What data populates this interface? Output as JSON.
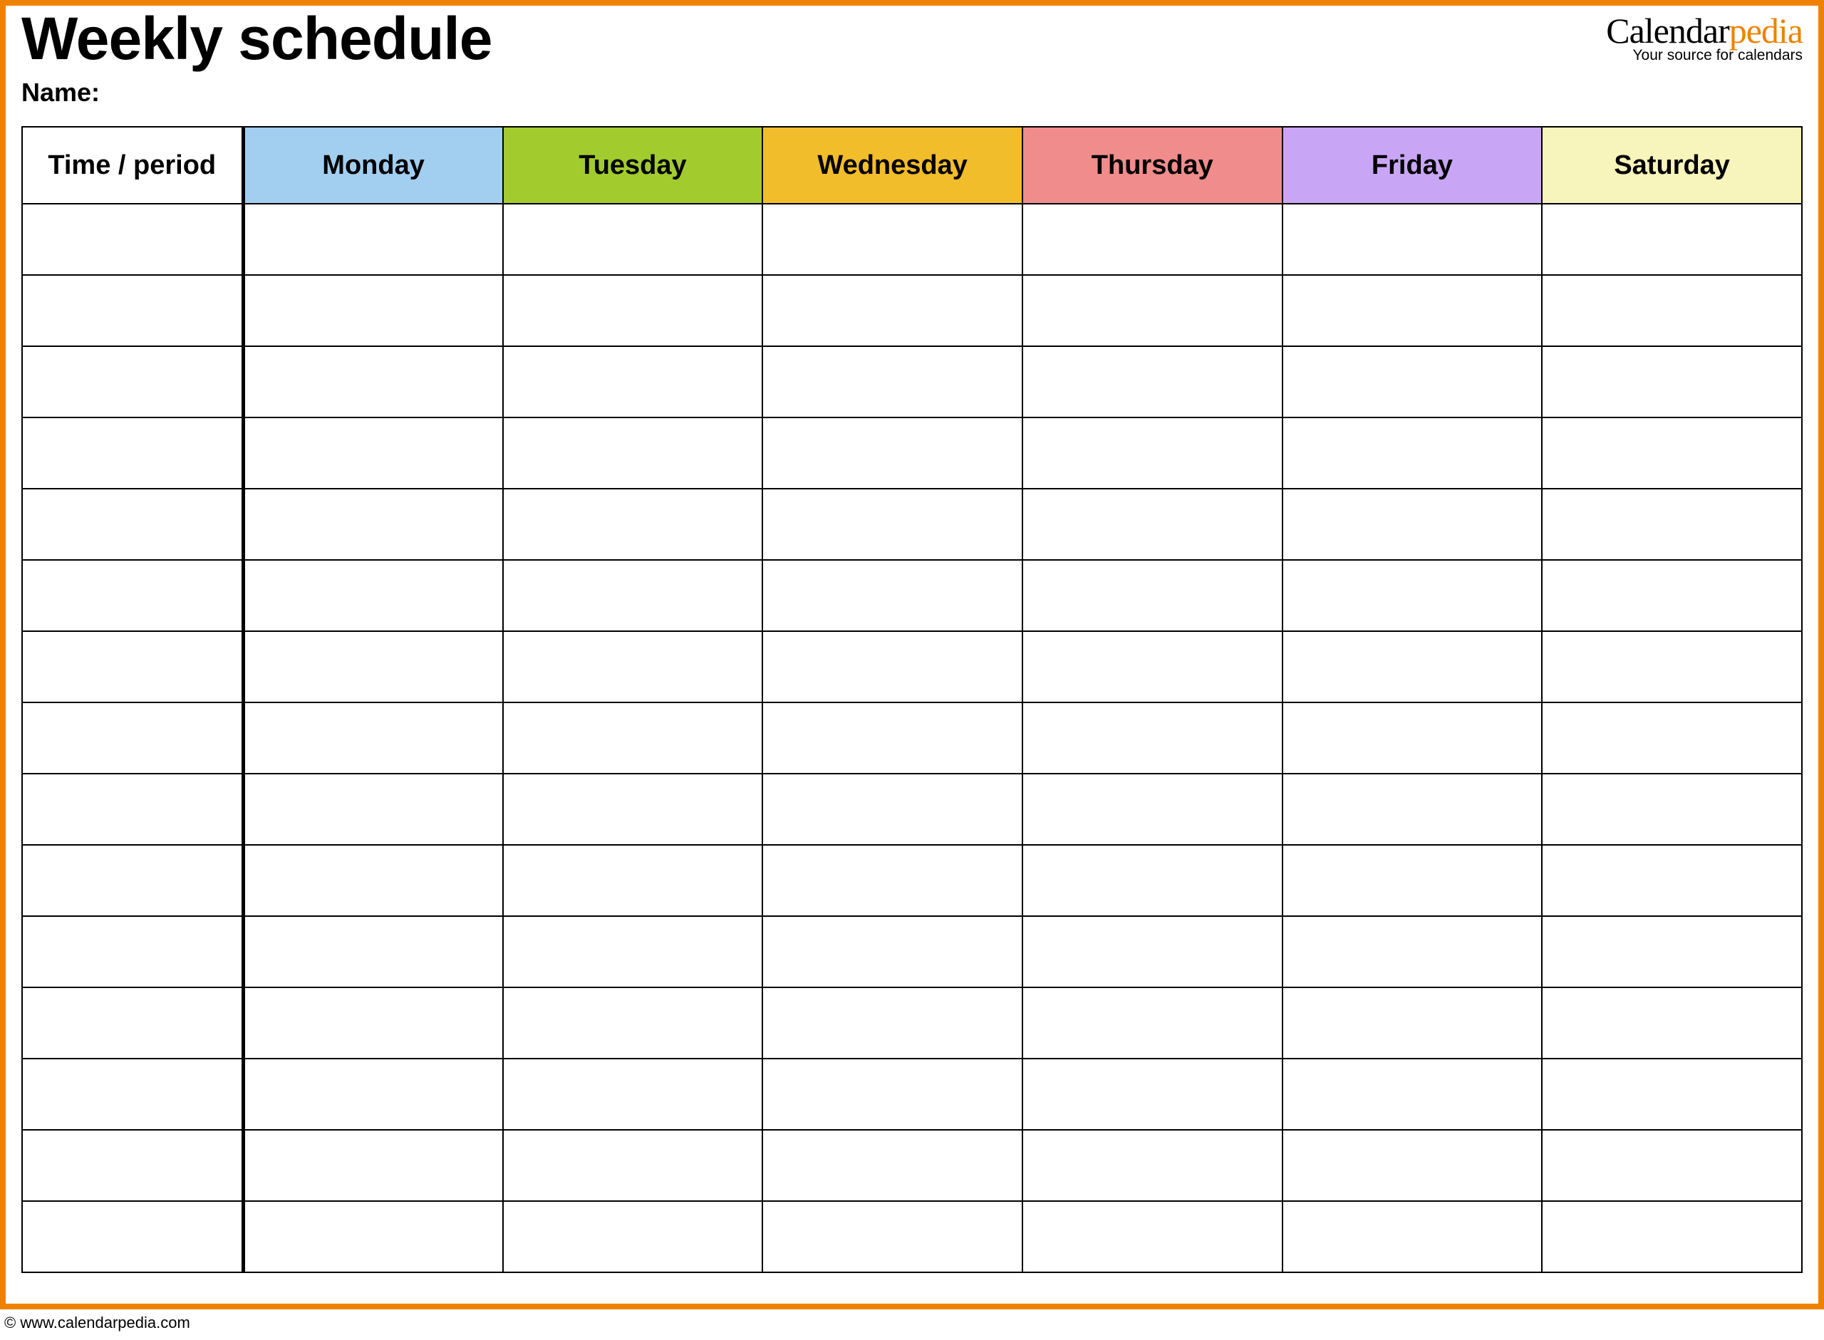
{
  "title": "Weekly schedule",
  "name_label": "Name:",
  "brand": {
    "prefix": "Calendar",
    "suffix": "pedia",
    "tag": "Your source for calendars"
  },
  "columns": {
    "time": {
      "label": "Time / period",
      "color": "#ffffff"
    },
    "days": [
      {
        "label": "Monday",
        "color": "#a2cef0"
      },
      {
        "label": "Tuesday",
        "color": "#a2cb2e"
      },
      {
        "label": "Wednesday",
        "color": "#f2bd2a"
      },
      {
        "label": "Thursday",
        "color": "#f08c8c"
      },
      {
        "label": "Friday",
        "color": "#c9a6f5"
      },
      {
        "label": "Saturday",
        "color": "#f7f4bc"
      }
    ]
  },
  "rows": [
    {
      "time": "",
      "cells": [
        "",
        "",
        "",
        "",
        "",
        ""
      ]
    },
    {
      "time": "",
      "cells": [
        "",
        "",
        "",
        "",
        "",
        ""
      ]
    },
    {
      "time": "",
      "cells": [
        "",
        "",
        "",
        "",
        "",
        ""
      ]
    },
    {
      "time": "",
      "cells": [
        "",
        "",
        "",
        "",
        "",
        ""
      ]
    },
    {
      "time": "",
      "cells": [
        "",
        "",
        "",
        "",
        "",
        ""
      ]
    },
    {
      "time": "",
      "cells": [
        "",
        "",
        "",
        "",
        "",
        ""
      ]
    },
    {
      "time": "",
      "cells": [
        "",
        "",
        "",
        "",
        "",
        ""
      ]
    },
    {
      "time": "",
      "cells": [
        "",
        "",
        "",
        "",
        "",
        ""
      ]
    },
    {
      "time": "",
      "cells": [
        "",
        "",
        "",
        "",
        "",
        ""
      ]
    },
    {
      "time": "",
      "cells": [
        "",
        "",
        "",
        "",
        "",
        ""
      ]
    },
    {
      "time": "",
      "cells": [
        "",
        "",
        "",
        "",
        "",
        ""
      ]
    },
    {
      "time": "",
      "cells": [
        "",
        "",
        "",
        "",
        "",
        ""
      ]
    },
    {
      "time": "",
      "cells": [
        "",
        "",
        "",
        "",
        "",
        ""
      ]
    },
    {
      "time": "",
      "cells": [
        "",
        "",
        "",
        "",
        "",
        ""
      ]
    },
    {
      "time": "",
      "cells": [
        "",
        "",
        "",
        "",
        "",
        ""
      ]
    }
  ],
  "footer": "© www.calendarpedia.com"
}
